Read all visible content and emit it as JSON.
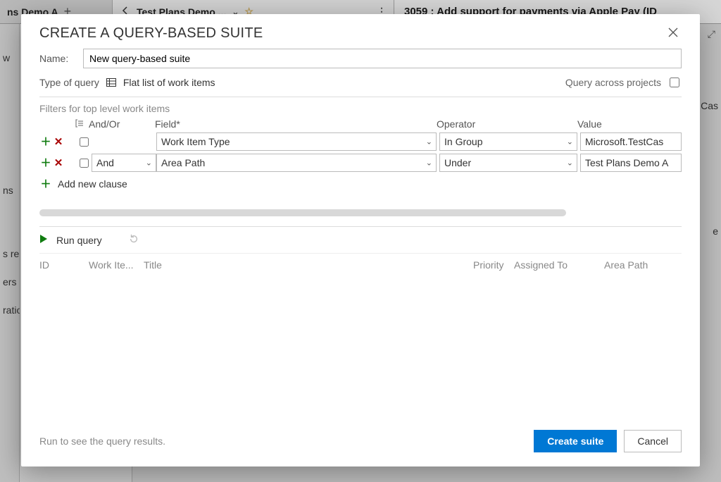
{
  "background": {
    "tab1_label": "ns Demo A",
    "tab2_label": "Test Plans Demo ...",
    "right_title": "3059 : Add support for payments via Apple Pay (ID",
    "side_fragments": {
      "w": "w",
      "ns": "ns",
      "sre": "s re",
      "ers": "ers",
      "ratio": "ratio"
    },
    "right_fragments": {
      "cas": "Cas",
      "e": "e"
    }
  },
  "dialog": {
    "title": "CREATE A QUERY-BASED SUITE",
    "name_label": "Name:",
    "name_value": "New query-based suite",
    "type_of_query_label": "Type of query",
    "type_of_query_value": "Flat list of work items",
    "query_across_label": "Query across projects",
    "filters_title": "Filters for top level work items",
    "headers": {
      "andor": "And/Or",
      "field": "Field*",
      "operator": "Operator",
      "value": "Value"
    },
    "rows": [
      {
        "andor": "",
        "field": "Work Item Type",
        "operator": "In Group",
        "value": "Microsoft.TestCas"
      },
      {
        "andor": "And",
        "field": "Area Path",
        "operator": "Under",
        "value": "Test Plans Demo A"
      }
    ],
    "add_clause": "Add new clause",
    "run_query": "Run query",
    "results_headers": {
      "id": "ID",
      "work_item": "Work Ite...",
      "title": "Title",
      "priority": "Priority",
      "assigned": "Assigned To",
      "area": "Area Path"
    },
    "hint": "Run to see the query results.",
    "create_btn": "Create suite",
    "cancel_btn": "Cancel"
  }
}
